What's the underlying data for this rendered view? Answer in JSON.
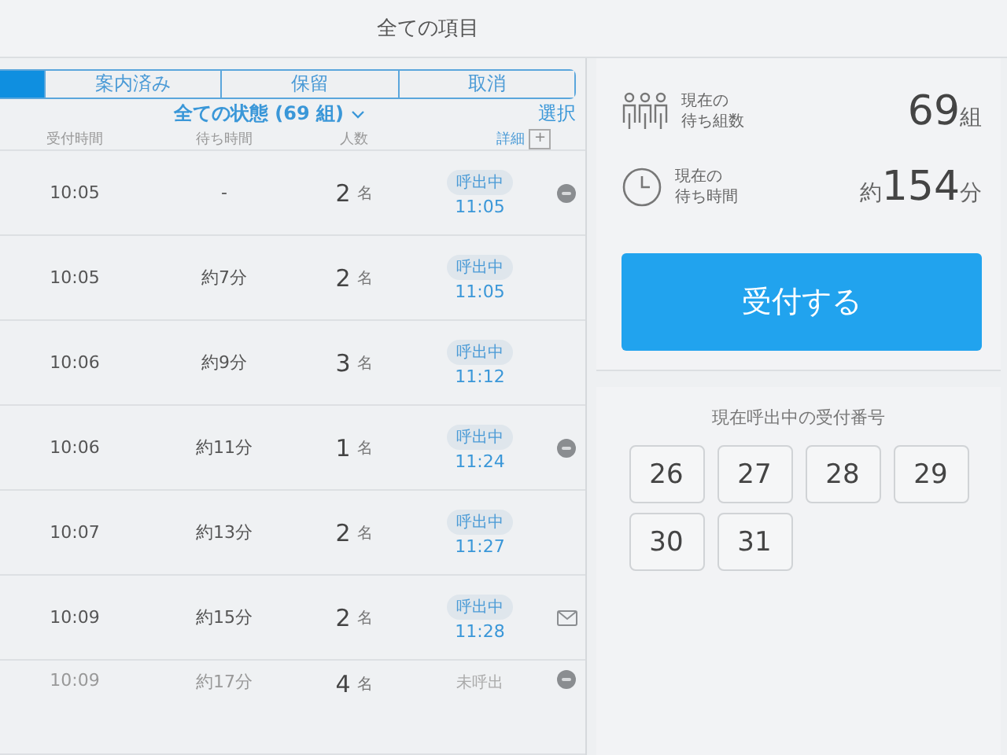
{
  "header": {
    "title": "全ての項目"
  },
  "tabs": [
    {
      "selected": true
    },
    {
      "label": "案内済み",
      "selected": false
    },
    {
      "label": "保留",
      "selected": false
    },
    {
      "label": "取消",
      "selected": false
    }
  ],
  "filter": {
    "label": "全ての状態 (69 組)",
    "action": "選択"
  },
  "table": {
    "columns": [
      "受付時間",
      "待ち時間",
      "人数"
    ],
    "detail": "詳細",
    "add": "+",
    "rows": [
      {
        "time": "10:05",
        "wait": "-",
        "count": "2",
        "unit": "名",
        "status": "呼出中",
        "called": "11:05",
        "called_state": true,
        "kind": "chat"
      },
      {
        "time": "10:05",
        "wait": "約7分",
        "count": "2",
        "unit": "名",
        "status": "呼出中",
        "called": "11:05",
        "called_state": true,
        "kind": "plain"
      },
      {
        "time": "10:06",
        "wait": "約9分",
        "count": "3",
        "unit": "名",
        "status": "呼出中",
        "called": "11:12",
        "called_state": true,
        "kind": "plain"
      },
      {
        "time": "10:06",
        "wait": "約11分",
        "count": "1",
        "unit": "名",
        "status": "呼出中",
        "called": "11:24",
        "called_state": true,
        "kind": "chat"
      },
      {
        "time": "10:07",
        "wait": "約13分",
        "count": "2",
        "unit": "名",
        "status": "呼出中",
        "called": "11:27",
        "called_state": true,
        "kind": "plain"
      },
      {
        "time": "10:09",
        "wait": "約15分",
        "count": "2",
        "unit": "名",
        "status": "呼出中",
        "called": "11:28",
        "called_state": true,
        "kind": "mail"
      },
      {
        "time": "10:09",
        "wait": "約17分",
        "count": "4",
        "unit": "名",
        "status": "未呼出",
        "called_state": false,
        "kind": "chat"
      }
    ]
  },
  "stats": [
    {
      "kind": "groups",
      "label_lines": [
        "現在の",
        "待ち組数"
      ],
      "value": "69",
      "unit": "組"
    },
    {
      "kind": "time",
      "label_lines": [
        "現在の",
        "待ち時間"
      ],
      "prefix": "約",
      "value": "154",
      "unit": "分"
    }
  ],
  "accept_button": "受付する",
  "calling": {
    "title": "現在呼出中の受付番号",
    "numbers": [
      "26",
      "27",
      "28",
      "29",
      "30",
      "31"
    ]
  }
}
